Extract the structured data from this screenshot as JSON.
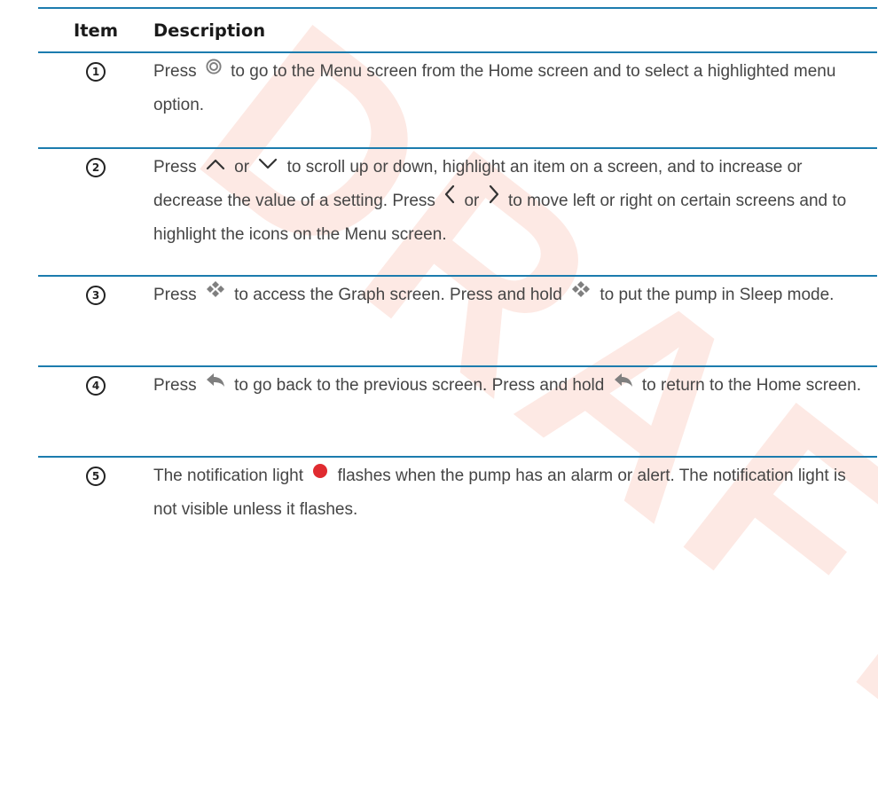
{
  "watermark": "DRAFT",
  "table": {
    "headers": {
      "item": "Item",
      "description": "Description"
    },
    "rows": [
      {
        "number": "1",
        "segments": [
          "Press",
          "to go to the Menu screen from the Home screen and to select a highlighted menu option."
        ]
      },
      {
        "number": "2",
        "segments": [
          "Press",
          "or",
          "to scroll up or down, highlight an item on a screen, and to increase or decrease the value of a setting. Press",
          "or",
          "to move left or right on certain screens and to highlight the icons on the Menu screen."
        ]
      },
      {
        "number": "3",
        "segments": [
          "Press",
          "to access the Graph screen. Press and hold",
          "to put the pump in Sleep mode."
        ]
      },
      {
        "number": "4",
        "segments": [
          "Press",
          "to go back to the previous screen. Press and hold",
          "to return to the Home screen."
        ]
      },
      {
        "number": "5",
        "segments": [
          "The notification light",
          "flashes when the pump has an alarm or alert. The notification light is not visible unless it flashes."
        ]
      }
    ]
  },
  "icons": {
    "select": "select-button-icon",
    "up": "up-arrow-icon",
    "down": "down-arrow-icon",
    "left": "left-arrow-icon",
    "right": "right-arrow-icon",
    "graph": "graph-button-icon",
    "back": "back-arrow-icon",
    "notification": "notification-light-icon"
  },
  "colors": {
    "rule": "#1c7cae",
    "icon_gray": "#7f7f7f",
    "notification_red": "#e02b30",
    "watermark": "#fde9e4"
  }
}
